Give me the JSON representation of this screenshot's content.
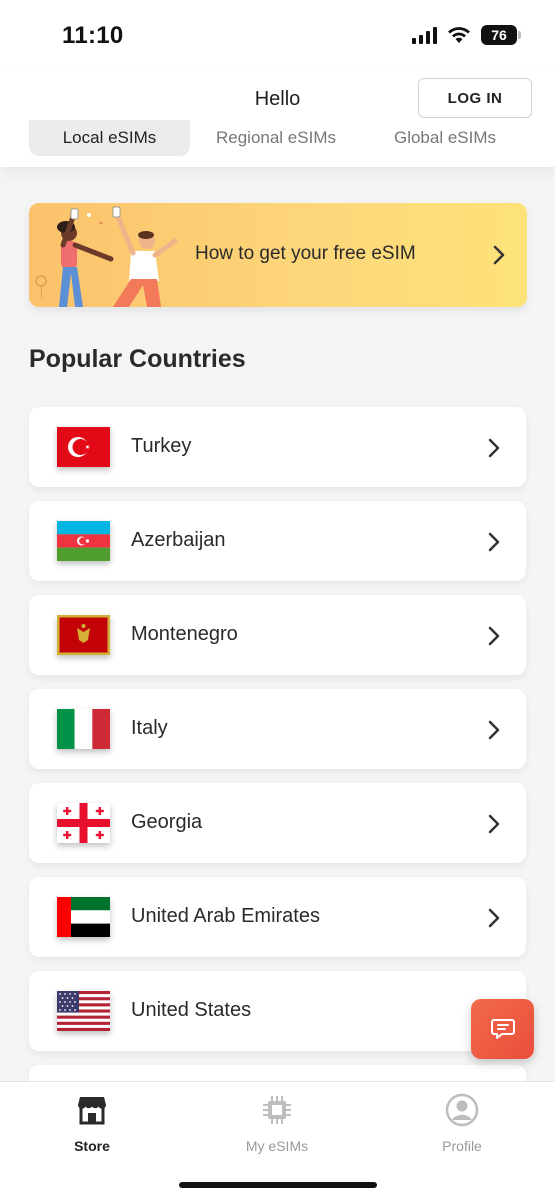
{
  "status_bar": {
    "time": "11:10",
    "battery": "76"
  },
  "header": {
    "title": "Hello",
    "login_label": "LOG IN",
    "tabs": [
      {
        "label": "Local eSIMs",
        "active": true
      },
      {
        "label": "Regional eSIMs",
        "active": false
      },
      {
        "label": "Global eSIMs",
        "active": false
      }
    ]
  },
  "promo": {
    "text": "How to get your free eSIM"
  },
  "section_title": "Popular Countries",
  "countries": [
    {
      "name": "Turkey",
      "flag": "turkey-flag"
    },
    {
      "name": "Azerbaijan",
      "flag": "azerbaijan-flag"
    },
    {
      "name": "Montenegro",
      "flag": "montenegro-flag"
    },
    {
      "name": "Italy",
      "flag": "italy-flag"
    },
    {
      "name": "Georgia",
      "flag": "georgia-flag"
    },
    {
      "name": "United Arab Emirates",
      "flag": "uae-flag"
    },
    {
      "name": "United States",
      "flag": "usa-flag"
    }
  ],
  "bottom_nav": [
    {
      "label": "Store",
      "icon": "store-icon",
      "active": true
    },
    {
      "label": "My eSIMs",
      "icon": "sim-chip-icon",
      "active": false
    },
    {
      "label": "Profile",
      "icon": "profile-icon",
      "active": false
    }
  ],
  "colors": {
    "accent": "#ea4e3c",
    "promo_start": "#fbc26b",
    "promo_end": "#fde27a"
  }
}
